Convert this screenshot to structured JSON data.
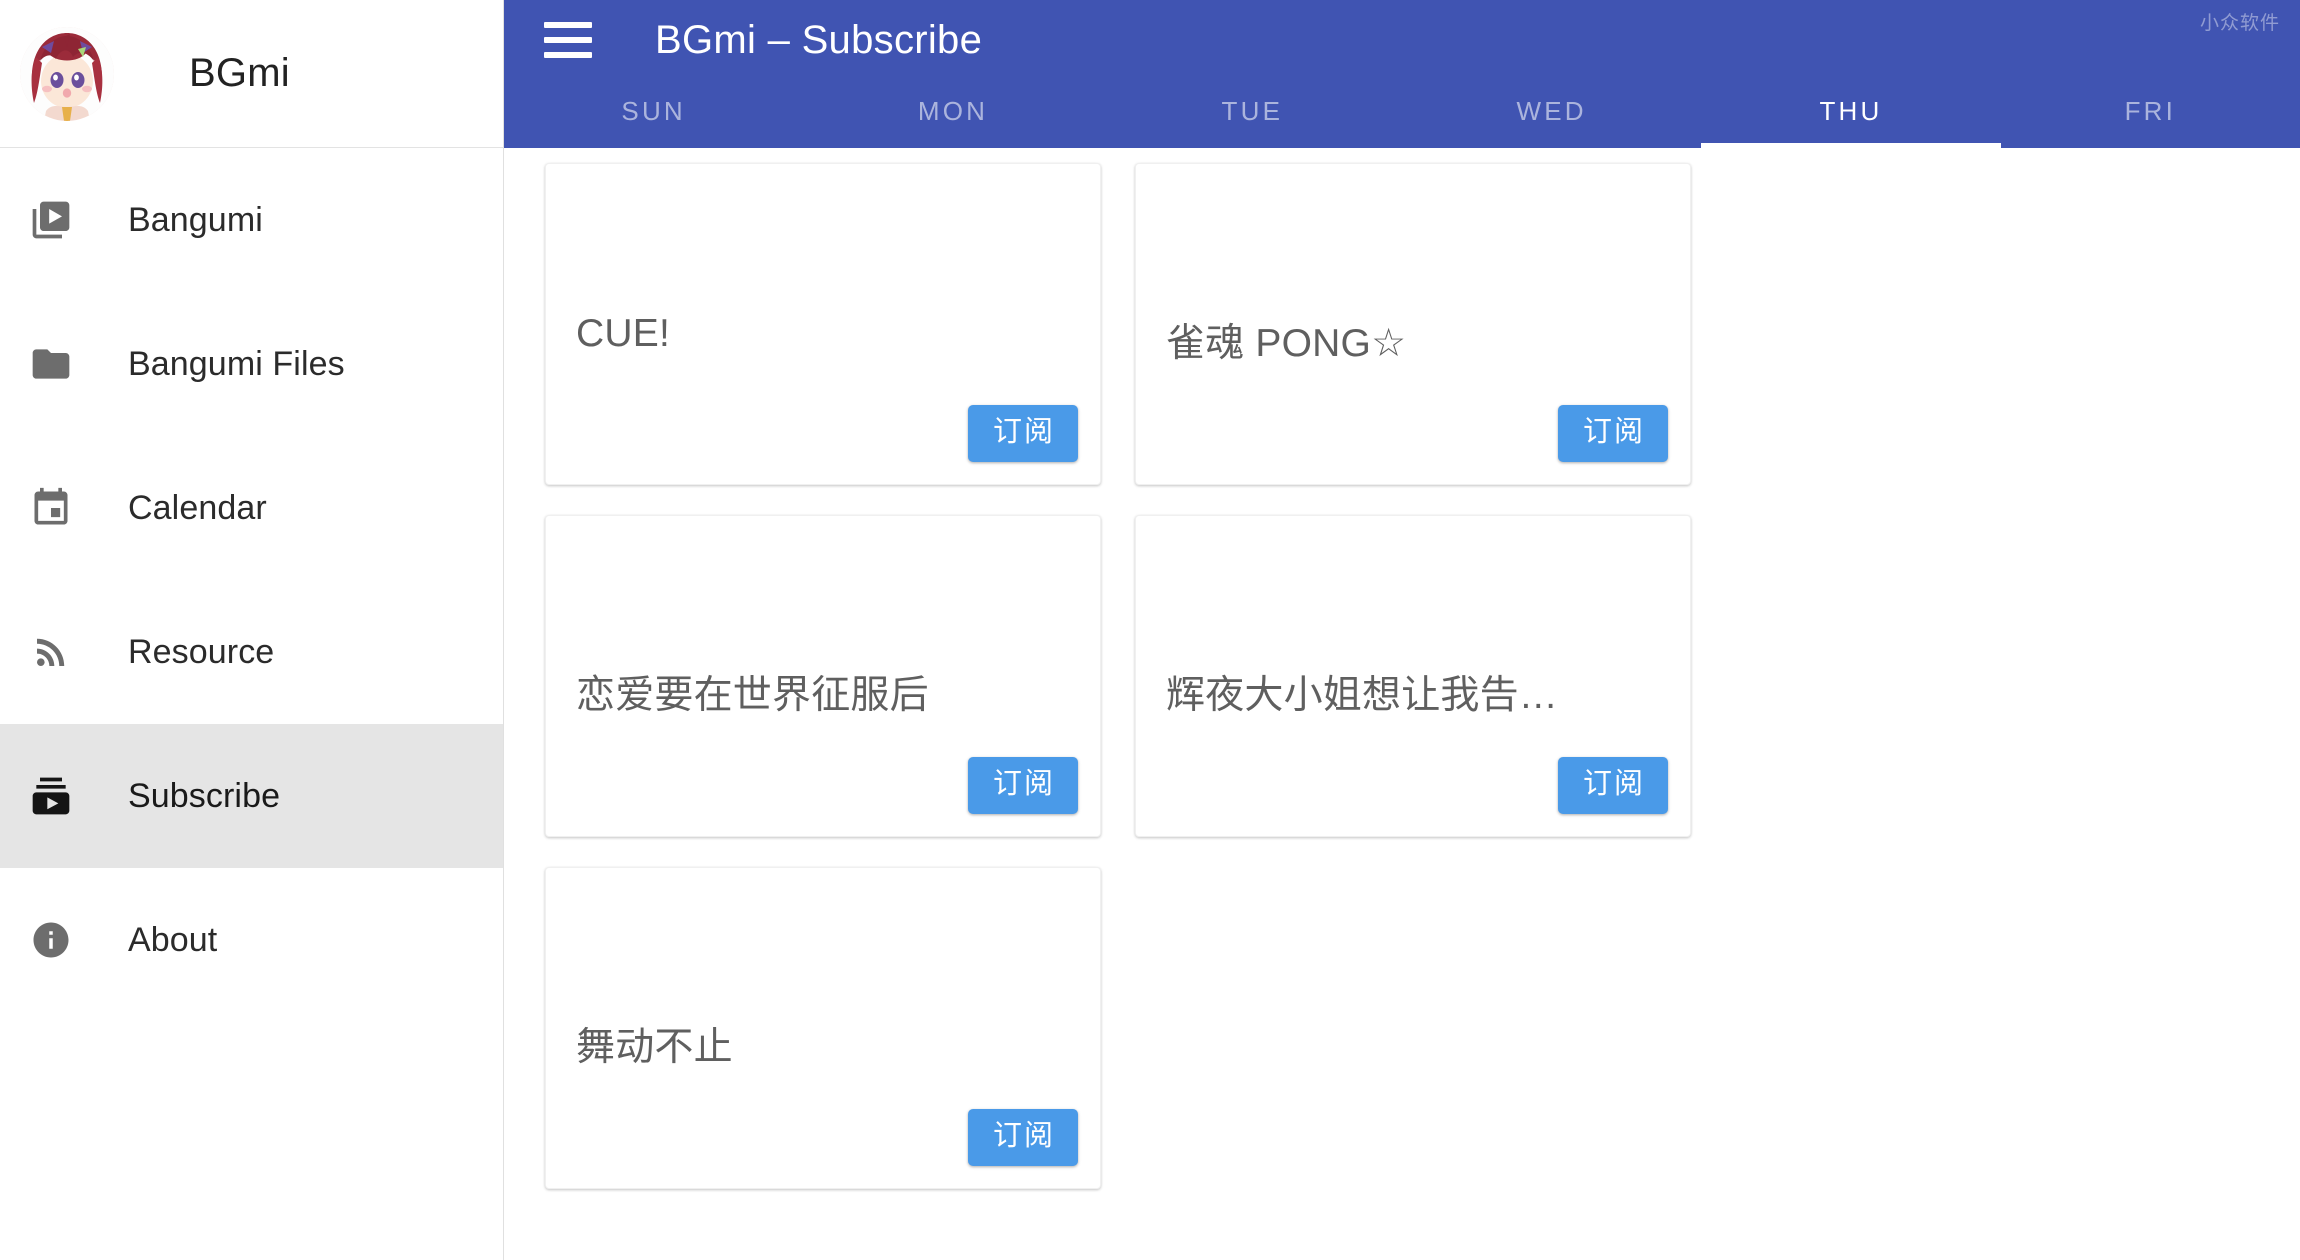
{
  "sidebar": {
    "brand": "BGmi",
    "avatar_alt": "anime-girl-avatar",
    "items": [
      {
        "label": "Bangumi",
        "icon": "video-library-icon",
        "active": false
      },
      {
        "label": "Bangumi Files",
        "icon": "folder-icon",
        "active": false
      },
      {
        "label": "Calendar",
        "icon": "calendar-icon",
        "active": false
      },
      {
        "label": "Resource",
        "icon": "rss-feed-icon",
        "active": false
      },
      {
        "label": "Subscribe",
        "icon": "subscriptions-icon",
        "active": true
      },
      {
        "label": "About",
        "icon": "info-icon",
        "active": false
      }
    ]
  },
  "appbar": {
    "menu_icon": "hamburger-menu-icon",
    "title": "BGmi – Subscribe",
    "watermark": "小众软件",
    "background_color": "#4054b2"
  },
  "tabs": {
    "items": [
      {
        "label": "SUN",
        "active": false
      },
      {
        "label": "MON",
        "active": false
      },
      {
        "label": "TUE",
        "active": false
      },
      {
        "label": "WED",
        "active": false
      },
      {
        "label": "THU",
        "active": true
      },
      {
        "label": "FRI",
        "active": false
      }
    ],
    "selected": "THU"
  },
  "main": {
    "subscribe_button_label": "订阅",
    "subscribe_button_color": "#4a9ae8",
    "cards": [
      {
        "title": "CUE!",
        "button": "订阅"
      },
      {
        "title": "雀魂 PONG☆",
        "button": "订阅"
      },
      {
        "title": "恋爱要在世界征服后",
        "button": "订阅"
      },
      {
        "title": "辉夜大小姐想让我告…",
        "button": "订阅"
      },
      {
        "title": "舞动不止",
        "button": "订阅"
      }
    ]
  }
}
